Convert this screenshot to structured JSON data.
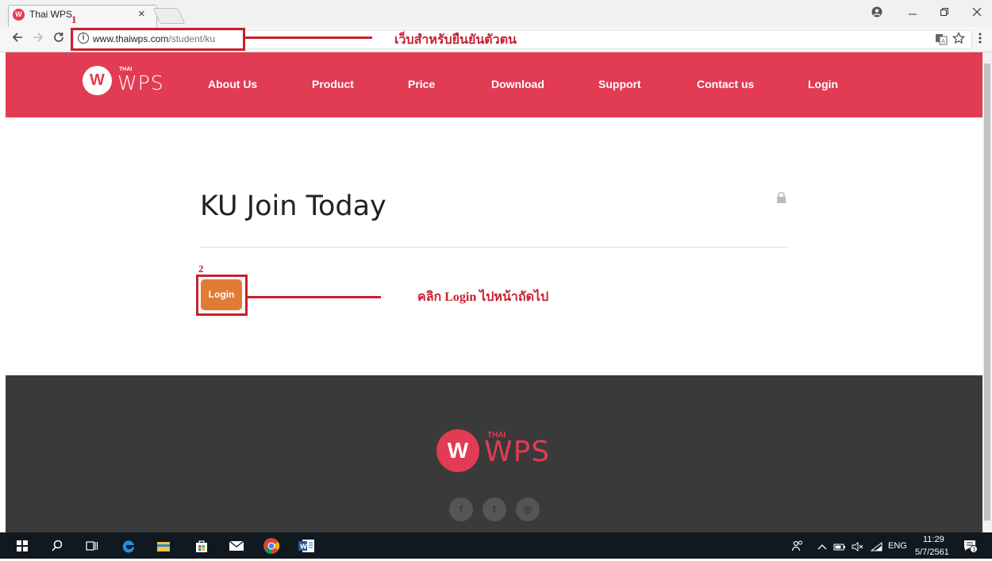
{
  "browser": {
    "tab_title": "Thai WPS",
    "favicon_letter": "W",
    "close_glyph": "×",
    "url_domain": "www.thaiwps.com",
    "url_path": "/student/ku",
    "info_glyph": "i"
  },
  "site": {
    "logo_letter": "W",
    "logo_thai": "THAI",
    "logo_wps": "WPS",
    "nav": [
      "About Us",
      "Product",
      "Price",
      "Download",
      "Support",
      "Contact us",
      "Login"
    ]
  },
  "content": {
    "title": "KU Join Today",
    "login_button": "Login"
  },
  "annotations": {
    "step1": "1",
    "step1_label": "เว็บสำหรับยืนยันตัวตน",
    "step2": "2",
    "step2_label": "คลิก Login ไปหน้าถัดไป"
  },
  "footer": {
    "logo_letter": "W",
    "logo_thai": "THAI",
    "logo_wps": "WPS",
    "social": [
      "f",
      "t",
      "◎"
    ]
  },
  "taskbar": {
    "language": "ENG",
    "time": "11:29",
    "date": "5/7/2561"
  },
  "colors": {
    "brand": "#e23b54",
    "button": "#e07b35",
    "annotation": "#c8202f",
    "footer": "#3a3a3a"
  }
}
